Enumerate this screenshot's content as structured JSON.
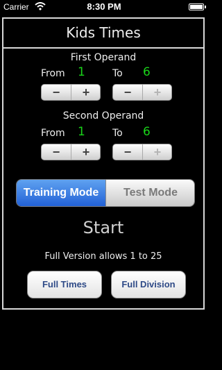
{
  "status_bar": {
    "carrier": "Carrier",
    "time": "8:30 PM"
  },
  "app": {
    "title": "Kids Times"
  },
  "first_operand": {
    "heading": "First Operand",
    "from_label": "From",
    "from_value": "1",
    "to_label": "To",
    "to_value": "6"
  },
  "second_operand": {
    "heading": "Second Operand",
    "from_label": "From",
    "from_value": "1",
    "to_label": "To",
    "to_value": "6"
  },
  "stepper": {
    "minus": "−",
    "plus": "+"
  },
  "mode": {
    "training": "Training Mode",
    "test": "Test Mode",
    "selected": "training"
  },
  "start": "Start",
  "note": "Full Version allows 1 to 25",
  "buttons": {
    "full_times": "Full Times",
    "full_division": "Full Division"
  },
  "colors": {
    "value": "#19d419",
    "selected_mode": "#2a6ad9",
    "button_text": "#2e4a87"
  }
}
